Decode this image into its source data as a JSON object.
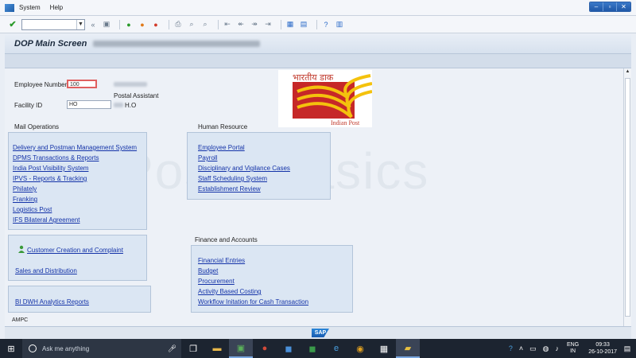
{
  "menubar": {
    "items": [
      {
        "label": "System",
        "accel": "S"
      },
      {
        "label": "Help",
        "accel": "H"
      }
    ]
  },
  "header": {
    "title": "DOP Main Screen"
  },
  "employee": {
    "number_label": "Employee Number",
    "number_value": "100",
    "designation": "Postal Assistant",
    "facility_label": "Facility ID",
    "facility_value": "HO",
    "facility_suffix": "H.O"
  },
  "logo": {
    "hindi": "भारतीय डाक",
    "english": "Indian Post"
  },
  "watermark": "PostalBasics",
  "mail_operations": {
    "title": "Mail Operations",
    "links": [
      "Delivery and Postman Management System",
      "DPMS Transactions & Reports",
      "India Post Visibility System",
      "IPVS - Reports & Tracking",
      "Philately",
      "Franking",
      "Logistics Post",
      "IFS Bilateral Agreement"
    ]
  },
  "customer": {
    "links": [
      "Customer Creation and Complaint",
      "Sales and Distribution"
    ]
  },
  "bi": {
    "link": "BI DWH Analytics Reports"
  },
  "human_resource": {
    "title": "Human Resource",
    "links": [
      "Employee Portal",
      "Payroll",
      "Disciplinary and Vigilance Cases",
      "Staff Scheduling System",
      "Establishment Review"
    ]
  },
  "finance": {
    "title": "Finance and Accounts",
    "links": [
      "Financial Entries",
      "Budget",
      "Procurement",
      "Activity Based Costing",
      "Workflow Initation for Cash Transaction"
    ]
  },
  "footer": {
    "ampc": "AMPC",
    "sap": "SAP"
  },
  "taskbar": {
    "search_placeholder": "Ask me anything",
    "lang_top": "ENG",
    "lang_bottom": "IN",
    "time": "09:33",
    "date": "26-10-2017"
  }
}
